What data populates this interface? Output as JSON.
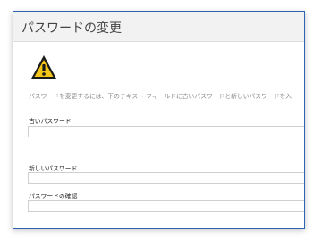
{
  "dialog": {
    "title": "パスワードの変更",
    "warning_icon": "warning-icon",
    "info_text": "パスワードを変更するには、下のテキスト フィールドに古いパスワードと新しいパスワードを入",
    "fields": {
      "old_password": {
        "label": "古いパスワード",
        "value": ""
      },
      "new_password": {
        "label": "新しいパスワード",
        "value": ""
      },
      "confirm_password": {
        "label": "パスワードの確認",
        "value": ""
      }
    }
  },
  "colors": {
    "border": "#2f63b4",
    "header_bg": "#f2f2f2",
    "warning_fill": "#f5c518"
  }
}
